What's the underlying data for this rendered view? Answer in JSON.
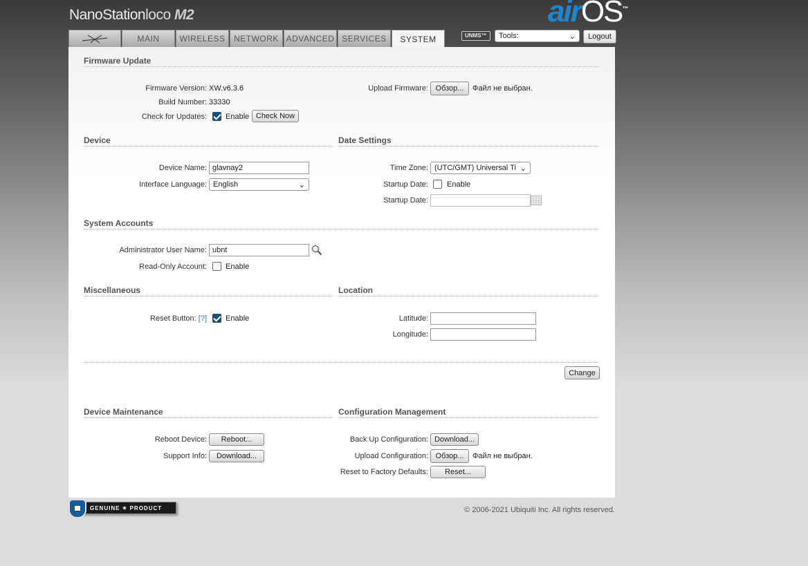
{
  "header": {
    "brand_main": "NanoStation",
    "brand_loco": "loco",
    "brand_model": "M2",
    "airos_air": "air",
    "airos_os": "OS",
    "airos_tm": "™"
  },
  "tabs": [
    {
      "label": ""
    },
    {
      "label": "MAIN"
    },
    {
      "label": "WIRELESS"
    },
    {
      "label": "NETWORK"
    },
    {
      "label": "ADVANCED"
    },
    {
      "label": "SERVICES"
    },
    {
      "label": "SYSTEM",
      "active": true
    }
  ],
  "toolbar": {
    "unms_label": "UNMS™",
    "tools_label": "Tools:",
    "logout_label": "Logout"
  },
  "firmware": {
    "title": "Firmware Update",
    "version_label": "Firmware Version:",
    "version_value": "XW.v6.3.6",
    "build_label": "Build Number:",
    "build_value": "33330",
    "check_label": "Check for Updates:",
    "check_enable": "Enable",
    "check_now": "Check Now",
    "upload_label": "Upload Firmware:",
    "browse": "Обзор...",
    "no_file": "Файл не выбран."
  },
  "device": {
    "title": "Device",
    "name_label": "Device Name:",
    "name_value": "glavnay2",
    "lang_label": "Interface Language:",
    "lang_value": "English"
  },
  "date": {
    "title": "Date Settings",
    "tz_label": "Time Zone:",
    "tz_value": "(UTC/GMT) Universal Ti",
    "startup_label": "Startup Date:",
    "startup_enable": "Enable",
    "startup_date_label": "Startup Date:",
    "startup_date_value": ""
  },
  "accounts": {
    "title": "System Accounts",
    "admin_label": "Administrator User Name:",
    "admin_value": "ubnt",
    "readonly_label": "Read-Only Account:",
    "readonly_enable": "Enable"
  },
  "misc": {
    "title": "Miscellaneous",
    "reset_label": "Reset Button:",
    "reset_help": "[?]",
    "reset_enable": "Enable"
  },
  "location": {
    "title": "Location",
    "lat_label": "Latitude:",
    "lat_value": "",
    "lon_label": "Longitude:",
    "lon_value": ""
  },
  "change_label": "Change",
  "maintenance": {
    "title": "Device Maintenance",
    "reboot_label": "Reboot Device:",
    "reboot_button": "Reboot...",
    "support_label": "Support Info:",
    "support_button": "Download..."
  },
  "config": {
    "title": "Configuration Management",
    "backup_label": "Back Up Configuration:",
    "backup_button": "Download...",
    "upload_label": "Upload Configuration:",
    "browse": "Обзор...",
    "no_file": "Файл не выбран.",
    "reset_label": "Reset to Factory Defaults:",
    "reset_button": "Reset..."
  },
  "footer": {
    "copyright": "© 2006-2021 Ubiquiti Inc. All rights reserved.",
    "genuine_text": "GENUINE ✶ PRODUCT"
  }
}
